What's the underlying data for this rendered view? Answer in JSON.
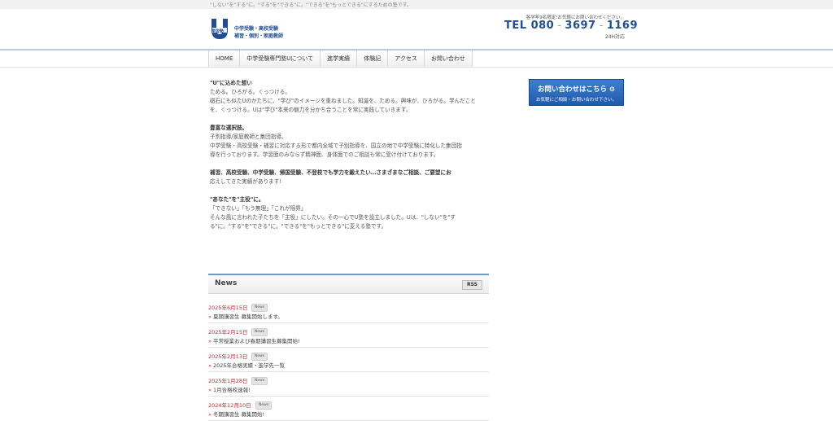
{
  "tagline": "\"しない\"を\"する\"に。\"する\"を\"できる\"に。\"できる\"を\"もっとできる\"にするための塾です。",
  "logo": {
    "mark_letter": "U",
    "mark_label": "学習塾",
    "line1": "中学受験・高校受験",
    "line2": "補習・個別・家庭教師"
  },
  "contact_header": {
    "note": "各学年9名限定!お気軽にお問い合わせください。",
    "tel_label": "TEL",
    "tel_parts": [
      "080",
      "3697",
      "1169"
    ],
    "hours": "24H対応"
  },
  "nav": [
    "HOME",
    "中学受験専門塾Uについて",
    "進学実績",
    "体験記",
    "アクセス",
    "お問い合わせ"
  ],
  "sections": [
    {
      "title": "\"U\"に込めた想い",
      "body": [
        "ためる。ひろがる。くっつける。",
        "磁石にも似たUのかたちに、\"学び\"のイメージを重ねました。知識を、ためる。興味が、ひろがる。学んだこと",
        "を、くっつける。Uは\"学び\"本来の魅力を分かち合うことを常に実践していきます。"
      ]
    },
    {
      "title": "豊富な選択肢。",
      "body": [
        "子別指導/家庭教師と集団指導。",
        "中学受験・高校受験・補習に対応する形で都内全域で子別指導を、国立の地で中学受験に特化した集団指",
        "導を行っております。学習面のみならず精神面、身体面でのご相談も常に受け付けております。"
      ]
    },
    {
      "title": "補習、高校受験、中学受験、帰国受験、不登校でも学力を鍛えたい…さまざまなご相談、ご要望にお",
      "body": [
        "応えしてきた実績があります!"
      ]
    },
    {
      "title": "\"あなた\"を\"主役\"に。",
      "body": [
        "「できない」「もう無理」「これが限界」",
        "そんな風に言われた子たちを「主役」にしたい。その一心でU塾を設立しました。Uは、\"しない\"を\"す",
        "る\"に。\"する\"を\"できる\"に。\"できる\"を\"もっとできる\"に変える塾です。"
      ]
    }
  ],
  "contact_button": {
    "title": "お問い合わせはこちら",
    "arrow": "⊙",
    "subtitle": "お気軽にご相談・お問い合わせ下さい。"
  },
  "news": {
    "title": "News",
    "rss_label": "RSS",
    "items": [
      {
        "date": "2025年6月15日",
        "tag": "News",
        "text": "夏期講習生 募集開始します。"
      },
      {
        "date": "2025年2月15日",
        "tag": "News",
        "text": "平常授業および春期講習生募集開始!"
      },
      {
        "date": "2025年2月13日",
        "tag": "News",
        "text": "2025年合格実績・進学先一覧"
      },
      {
        "date": "2025年1月28日",
        "tag": "News",
        "text": "1月合格校速報!"
      },
      {
        "date": "2024年12月10日",
        "tag": "News",
        "text": "冬期講習生 募集開始!"
      }
    ]
  },
  "colors": {
    "brand_blue": "#1f4e93",
    "accent_red": "#cc2233",
    "button_blue": "#2a66b8"
  }
}
